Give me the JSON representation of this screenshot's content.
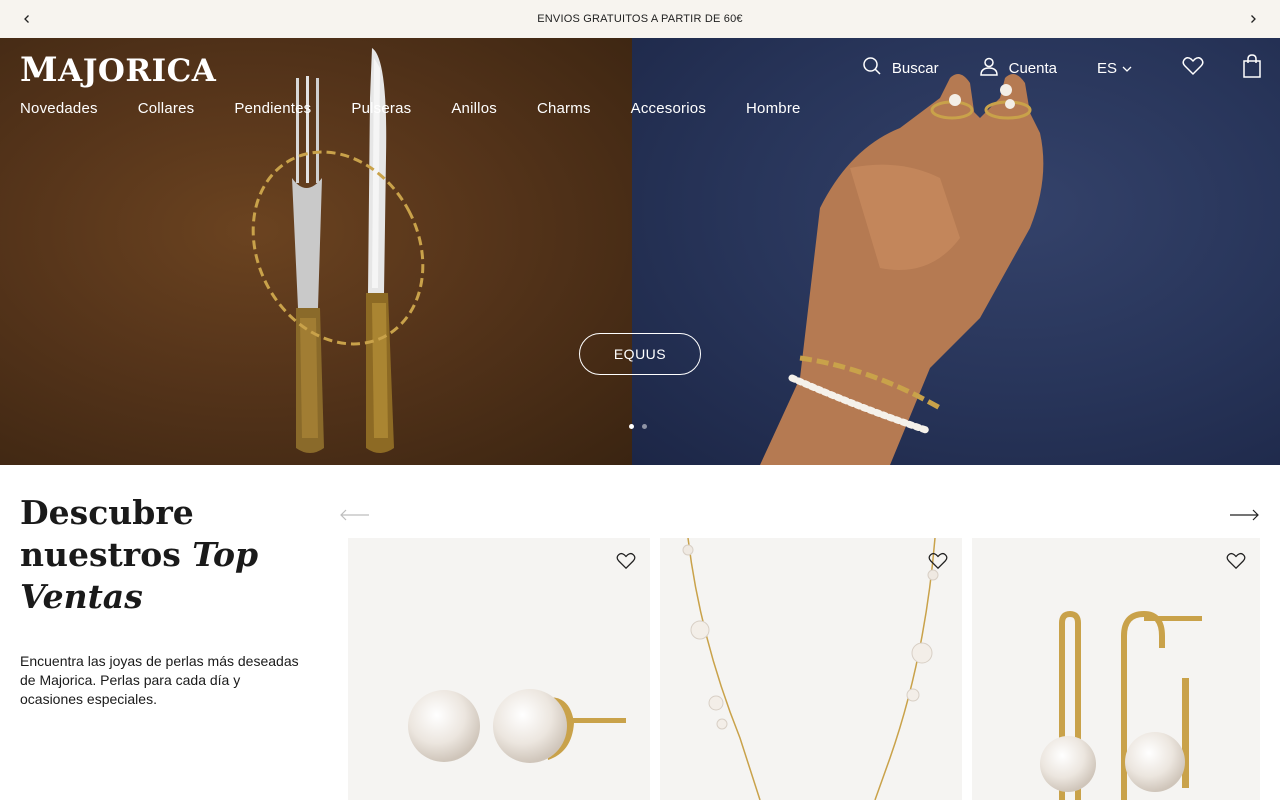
{
  "announcement": {
    "text": "ENVIOS GRATUITOS A PARTIR DE 60€",
    "prev_icon": "chevron-left-icon",
    "next_icon": "chevron-right-icon"
  },
  "header": {
    "logo_initial": "M",
    "logo_rest": "AJORICA",
    "nav": [
      {
        "label": "Novedades"
      },
      {
        "label": "Collares"
      },
      {
        "label": "Pendientes"
      },
      {
        "label": "Pulseras"
      },
      {
        "label": "Anillos"
      },
      {
        "label": "Charms"
      },
      {
        "label": "Accesorios"
      },
      {
        "label": "Hombre"
      }
    ],
    "search_label": "Buscar",
    "account_label": "Cuenta",
    "language": "ES"
  },
  "hero": {
    "cta_label": "EQUUS",
    "slides_count": 2,
    "active_slide": 1
  },
  "top_sales": {
    "title_line1": "Descubre",
    "title_line2_plain": "nuestros ",
    "title_line2_italic": "Top",
    "title_line3_italic": "Ventas",
    "description": "Encuentra las joyas de perlas más deseadas de Majorica. Perlas para cada día y ocasiones especiales."
  },
  "colors": {
    "announcement_bg": "#f7f4ef",
    "card_bg": "#f5f4f2",
    "text": "#1a1a1a",
    "gold": "#c9a24a"
  }
}
